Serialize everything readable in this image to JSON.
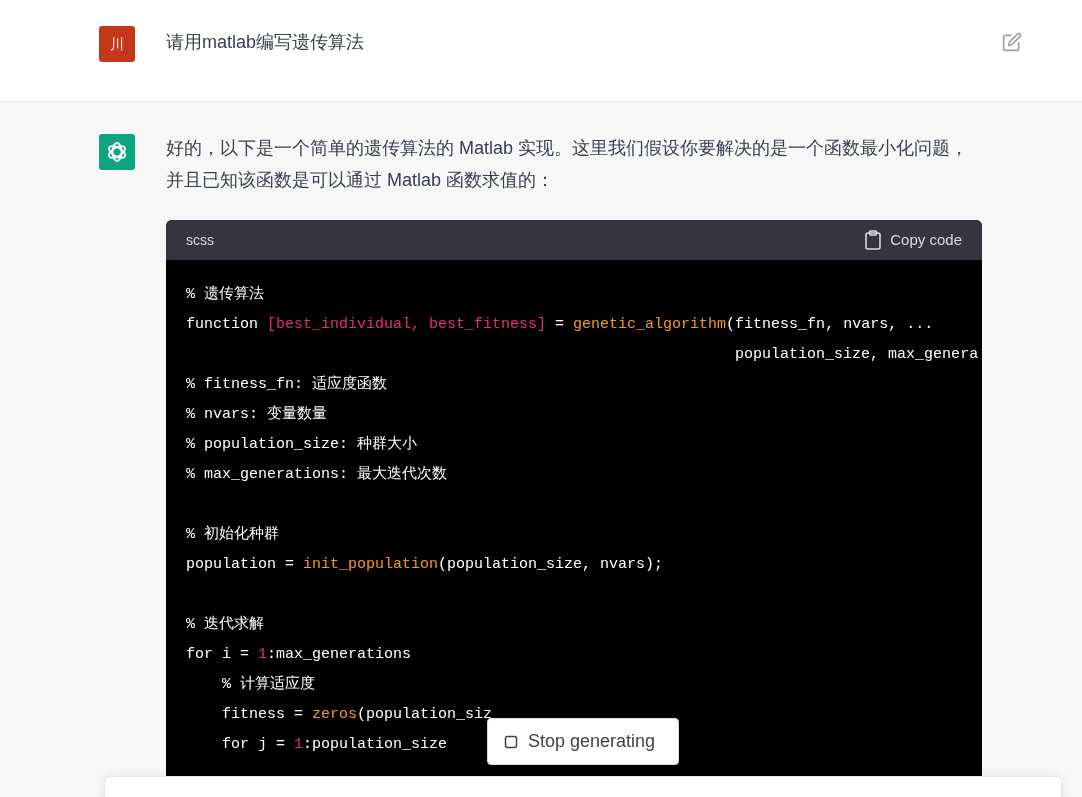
{
  "user_message": {
    "avatar_text": "川",
    "text": "请用matlab编写遗传算法"
  },
  "assistant_message": {
    "text": "好的，以下是一个简单的遗传算法的 Matlab 实现。这里我们假设你要解决的是一个函数最小化问题，并且已知该函数是可以通过 Matlab 函数求值的：",
    "code_block": {
      "language": "scss",
      "copy_label": "Copy code",
      "lines": [
        {
          "kind": "code",
          "tokens": [
            {
              "kind": "plain",
              "text": "% 遗传算法"
            }
          ]
        },
        {
          "kind": "code",
          "tokens": [
            {
              "kind": "plain",
              "text": "function "
            },
            {
              "kind": "string",
              "text": "[best_individual, best_fitness]"
            },
            {
              "kind": "plain",
              "text": " = "
            },
            {
              "kind": "func",
              "text": "genetic_algorithm"
            },
            {
              "kind": "plain",
              "text": "(fitness_fn, nvars, ..."
            }
          ]
        },
        {
          "kind": "code",
          "tokens": [
            {
              "kind": "plain",
              "text": "                                                             population_size, max_genera"
            }
          ]
        },
        {
          "kind": "code",
          "tokens": [
            {
              "kind": "plain",
              "text": "% fitness_fn: 适应度函数"
            }
          ]
        },
        {
          "kind": "code",
          "tokens": [
            {
              "kind": "plain",
              "text": "% nvars: 变量数量"
            }
          ]
        },
        {
          "kind": "code",
          "tokens": [
            {
              "kind": "plain",
              "text": "% population_size: 种群大小"
            }
          ]
        },
        {
          "kind": "code",
          "tokens": [
            {
              "kind": "plain",
              "text": "% max_generations: 最大迭代次数"
            }
          ]
        },
        {
          "kind": "blank"
        },
        {
          "kind": "code",
          "tokens": [
            {
              "kind": "plain",
              "text": "% 初始化种群"
            }
          ]
        },
        {
          "kind": "code",
          "tokens": [
            {
              "kind": "plain",
              "text": "population = "
            },
            {
              "kind": "func",
              "text": "init_population"
            },
            {
              "kind": "plain",
              "text": "(population_size, nvars);"
            }
          ]
        },
        {
          "kind": "blank"
        },
        {
          "kind": "code",
          "tokens": [
            {
              "kind": "plain",
              "text": "% 迭代求解"
            }
          ]
        },
        {
          "kind": "code",
          "tokens": [
            {
              "kind": "plain",
              "text": "for i = "
            },
            {
              "kind": "number",
              "text": "1"
            },
            {
              "kind": "plain",
              "text": ":max_generations"
            }
          ]
        },
        {
          "kind": "code",
          "tokens": [
            {
              "kind": "plain",
              "text": "    % 计算适应度"
            }
          ]
        },
        {
          "kind": "code",
          "tokens": [
            {
              "kind": "plain",
              "text": "    fitness = "
            },
            {
              "kind": "func",
              "text": "zeros"
            },
            {
              "kind": "plain",
              "text": "(population_siz"
            }
          ]
        },
        {
          "kind": "code",
          "tokens": [
            {
              "kind": "plain",
              "text": "    for j = "
            },
            {
              "kind": "number",
              "text": "1"
            },
            {
              "kind": "plain",
              "text": ":population_size"
            }
          ]
        }
      ]
    }
  },
  "stop_button": {
    "label": "Stop generating"
  }
}
